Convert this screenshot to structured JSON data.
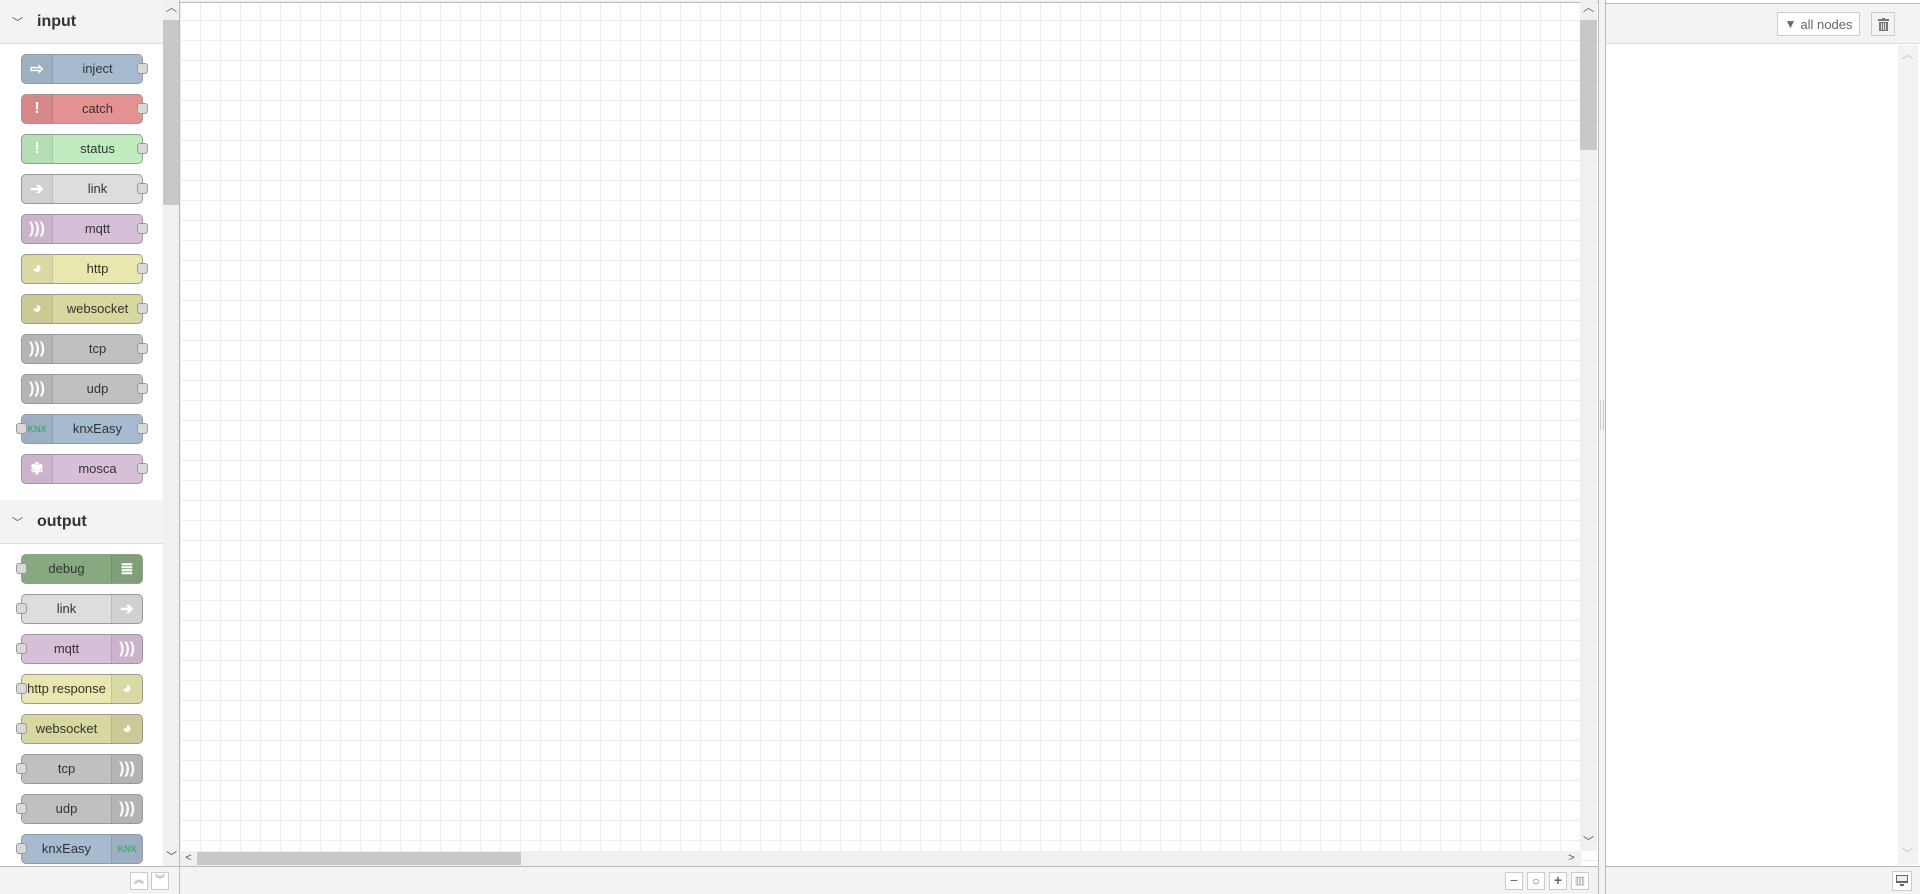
{
  "palette": {
    "categories": [
      {
        "name": "input",
        "nodes": [
          {
            "label": "inject",
            "color": "#a6bbcf",
            "icon": "arrow-in-icon",
            "glyph": "⇨",
            "side": "left",
            "in": false,
            "out": true
          },
          {
            "label": "catch",
            "color": "#e49191",
            "icon": "alert-icon",
            "glyph": "!",
            "side": "left",
            "in": false,
            "out": true
          },
          {
            "label": "status",
            "color": "#c0edc0",
            "icon": "alert-icon",
            "glyph": "!",
            "side": "left",
            "in": false,
            "out": true
          },
          {
            "label": "link",
            "color": "#dddddd",
            "icon": "link-in-icon",
            "glyph": "➔",
            "side": "left",
            "in": false,
            "out": true
          },
          {
            "label": "mqtt",
            "color": "#d8bfd8",
            "icon": "bridge-icon",
            "glyph": ")))",
            "side": "left",
            "in": false,
            "out": true
          },
          {
            "label": "http",
            "color": "#e7e7ae",
            "icon": "globe-icon",
            "glyph": "◕",
            "side": "left",
            "in": false,
            "out": true
          },
          {
            "label": "websocket",
            "color": "#d7d7a0",
            "icon": "globe-icon",
            "glyph": "◕",
            "side": "left",
            "in": false,
            "out": true
          },
          {
            "label": "tcp",
            "color": "#c0c0c0",
            "icon": "bridge-icon",
            "glyph": ")))",
            "side": "left",
            "in": false,
            "out": true
          },
          {
            "label": "udp",
            "color": "#c0c0c0",
            "icon": "bridge-icon",
            "glyph": ")))",
            "side": "left",
            "in": false,
            "out": true
          },
          {
            "label": "knxEasy",
            "color": "#a6bbcf",
            "icon": "knx-logo-icon",
            "glyph": "KNX",
            "side": "left",
            "in": true,
            "out": true
          },
          {
            "label": "mosca",
            "color": "#d8bfd8",
            "icon": "mosca-icon",
            "glyph": "✾",
            "side": "left",
            "in": false,
            "out": true
          }
        ]
      },
      {
        "name": "output",
        "nodes": [
          {
            "label": "debug",
            "color": "#87a980",
            "icon": "debug-list-icon",
            "glyph": "≣",
            "side": "right",
            "in": true,
            "out": false
          },
          {
            "label": "link",
            "color": "#dddddd",
            "icon": "link-out-icon",
            "glyph": "➔",
            "side": "right",
            "in": true,
            "out": false
          },
          {
            "label": "mqtt",
            "color": "#d8bfd8",
            "icon": "bridge-icon",
            "glyph": ")))",
            "side": "right",
            "in": true,
            "out": false
          },
          {
            "label": "http response",
            "color": "#e7e7ae",
            "icon": "globe-icon",
            "glyph": "◕",
            "side": "right",
            "in": true,
            "out": false
          },
          {
            "label": "websocket",
            "color": "#d7d7a0",
            "icon": "globe-icon",
            "glyph": "◕",
            "side": "right",
            "in": true,
            "out": false
          },
          {
            "label": "tcp",
            "color": "#c0c0c0",
            "icon": "bridge-icon",
            "glyph": ")))",
            "side": "right",
            "in": true,
            "out": false
          },
          {
            "label": "udp",
            "color": "#c0c0c0",
            "icon": "bridge-icon",
            "glyph": ")))",
            "side": "right",
            "in": true,
            "out": false
          },
          {
            "label": "knxEasy",
            "color": "#a6bbcf",
            "icon": "knx-logo-icon",
            "glyph": "KNX",
            "side": "right",
            "in": true,
            "out": false
          }
        ]
      }
    ]
  },
  "sidebar": {
    "filter_label": "all nodes"
  }
}
